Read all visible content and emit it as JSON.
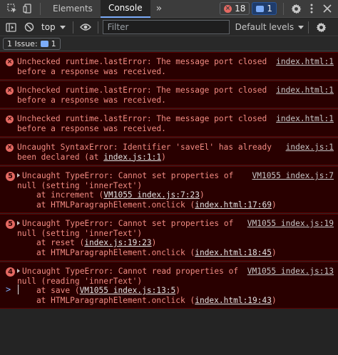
{
  "toolbar": {
    "tabs": [
      "Elements",
      "Console"
    ],
    "more_tabs": "»",
    "error_count": "18",
    "issue_count": "1"
  },
  "filterbar": {
    "context": "top",
    "filter_placeholder": "Filter",
    "levels": "Default levels"
  },
  "issues": {
    "label": "1 Issue:",
    "count": "1"
  },
  "messages": [
    {
      "lines": [
        "Unchecked runtime.lastError: The message port closed",
        "before a response was received."
      ],
      "source": "index.html:1"
    },
    {
      "lines": [
        "Unchecked runtime.lastError: The message port closed",
        "before a response was received."
      ],
      "source": "index.html:1"
    },
    {
      "lines": [
        "Unchecked runtime.lastError: The message port closed",
        "before a response was received."
      ],
      "source": "index.html:1"
    },
    {
      "lines": [
        "Uncaught SyntaxError: Identifier 'saveEl' has already",
        "been declared (at "
      ],
      "link": "index.js:1:1",
      "tail": ")",
      "source": "index.js:1"
    },
    {
      "count": "5",
      "lines": [
        "Uncaught TypeError: Cannot set properties of",
        "null (setting 'innerText')"
      ],
      "stack": [
        {
          "prefix": "    at increment (",
          "link": "VM1055 index.js:7:23",
          "suffix": ")"
        },
        {
          "prefix": "    at HTMLParagraphElement.onclick (",
          "link": "index.html:17:69",
          "suffix": ")"
        }
      ],
      "source": "VM1055 index.js:7"
    },
    {
      "count": "5",
      "lines": [
        "Uncaught TypeError: Cannot set properties of",
        "null (setting 'innerText')"
      ],
      "stack": [
        {
          "prefix": "    at reset (",
          "link": "index.js:19:23",
          "suffix": ")"
        },
        {
          "prefix": "    at HTMLParagraphElement.onclick (",
          "link": "index.html:18:45",
          "suffix": ")"
        }
      ],
      "source": "VM1055 index.js:19"
    },
    {
      "count": "4",
      "lines": [
        "Uncaught TypeError: Cannot read properties of",
        "null (reading 'innerText')"
      ],
      "stack": [
        {
          "prefix": "    at save (",
          "link": "VM1055 index.js:13:5",
          "suffix": ")"
        },
        {
          "prefix": "    at HTMLParagraphElement.onclick (",
          "link": "index.html:19:43",
          "suffix": ")"
        }
      ],
      "source": "VM1055 index.js:13"
    }
  ],
  "prompt": ">"
}
